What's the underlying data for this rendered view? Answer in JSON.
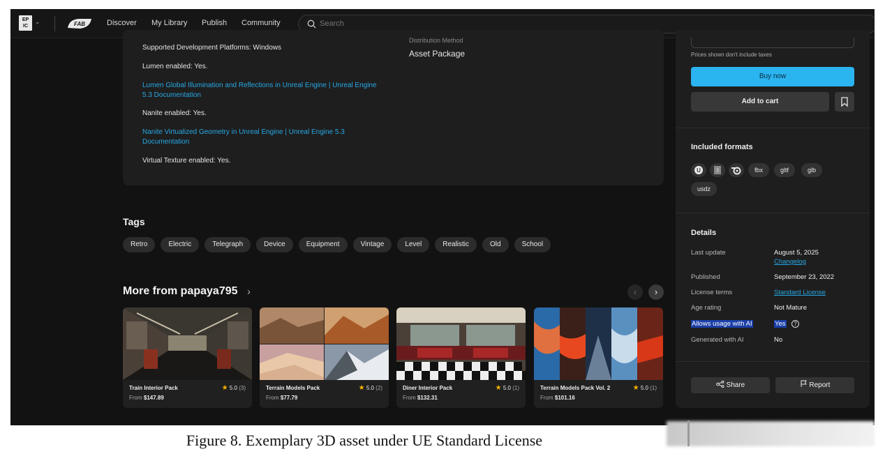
{
  "topnav": {
    "epic_logo": "EPIC GAMES",
    "fab_logo": "FAB",
    "links": [
      "Discover",
      "My Library",
      "Publish",
      "Community"
    ],
    "search_placeholder": "Search"
  },
  "tech": {
    "dist_label": "Distribution Method",
    "dist_value": "Asset Package",
    "platforms": "Supported Development Platforms: Windows",
    "lumen": " Lumen enabled: Yes.",
    "lumen_link": "Lumen Global Illumination and Reflections in Unreal Engine | Unreal Engine 5.3 Documentation",
    "nanite": "Nanite enabled: Yes.",
    "nanite_link": "Nanite Virtualized Geometry in Unreal Engine | Unreal Engine 5.3 Documentation",
    "virtual_texture": "Virtual Texture enabled: Yes."
  },
  "tags": {
    "title": "Tags",
    "items": [
      "Retro",
      "Electric",
      "Telegraph",
      "Device",
      "Equipment",
      "Vintage",
      "Level",
      "Realistic",
      "Old",
      "School"
    ]
  },
  "more": {
    "title": "More from papaya795",
    "cards": [
      {
        "title": "Train Interior Pack",
        "rating": "5.0",
        "count": "(3)",
        "from": "From",
        "price": "$147.89"
      },
      {
        "title": "Terrain Models Pack",
        "rating": "5.0",
        "count": "(2)",
        "from": "From",
        "price": "$77.79"
      },
      {
        "title": "Diner Interior Pack",
        "rating": "5.0",
        "count": "(1)",
        "from": "From",
        "price": "$132.31"
      },
      {
        "title": "Terrain Models Pack Vol. 2",
        "rating": "5.0",
        "count": "(1)",
        "from": "From",
        "price": "$101.16"
      }
    ]
  },
  "sidebar": {
    "tax_note": "Prices shown don't include taxes",
    "buy_now": "Buy now",
    "add_to_cart": "Add to cart",
    "formats_title": "Included formats",
    "format_icons": [
      "unreal-engine-icon",
      "3ds-max-icon",
      "blender-icon"
    ],
    "formats": [
      "fbx",
      "gltf",
      "glb",
      "usdz"
    ],
    "details_title": "Details",
    "details": {
      "last_update_label": "Last update",
      "last_update_value": "August 5, 2025",
      "changelog": "Changelog",
      "published_label": "Published",
      "published_value": "September 23, 2022",
      "license_label": "License terms",
      "license_value": "Standard License",
      "age_label": "Age rating",
      "age_value": "Not Mature",
      "ai_usage_label": "Allows usage with AI",
      "ai_usage_value": "Yes",
      "generated_label": "Generated with AI",
      "generated_value": "No"
    },
    "share": "Share",
    "report": "Report"
  },
  "colors": {
    "accent": "#2ab4f0",
    "link": "#27a9e6",
    "highlight": "#1a3fa8",
    "star": "#f5b301"
  },
  "caption": "Figure 8. Exemplary 3D asset under UE Standard License"
}
